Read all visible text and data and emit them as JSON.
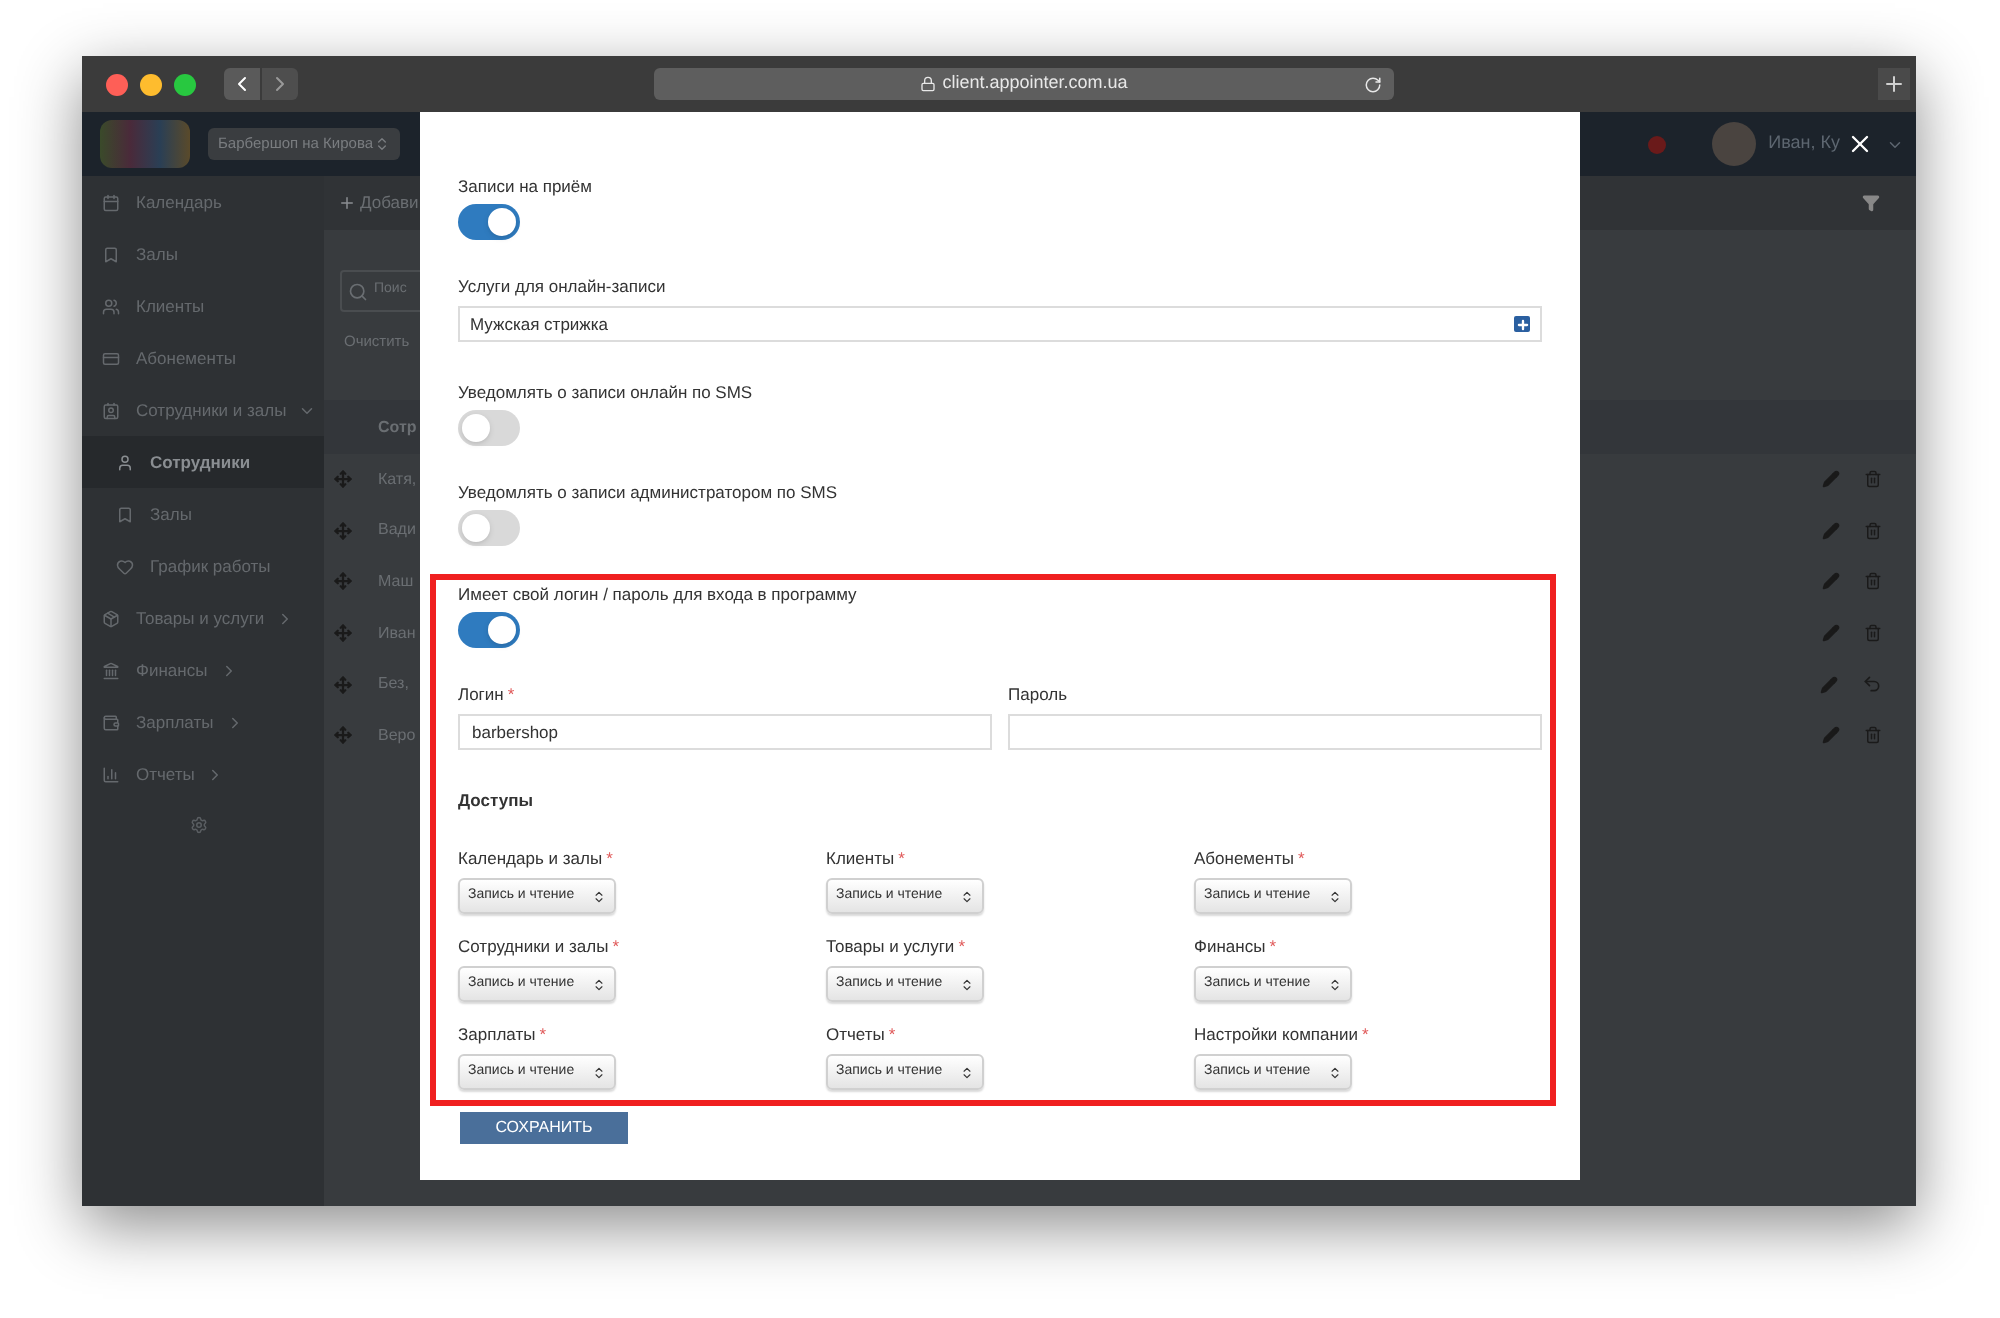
{
  "browser": {
    "url": "client.appointer.com.ua"
  },
  "app_header": {
    "company_select": "Барбершоп на Кирова",
    "user_name": "Иван, Ку"
  },
  "sidebar": {
    "items": [
      {
        "label": "Календарь",
        "kind": "link",
        "selected": false
      },
      {
        "label": "Залы",
        "kind": "link",
        "selected": false
      },
      {
        "label": "Клиенты",
        "kind": "link",
        "selected": false
      },
      {
        "label": "Абонементы",
        "kind": "link",
        "selected": false
      },
      {
        "label": "Сотрудники и залы",
        "kind": "group",
        "expanded": true,
        "selected": false,
        "children": [
          {
            "label": "Сотрудники",
            "selected": true
          },
          {
            "label": "Залы",
            "selected": false
          },
          {
            "label": "График работы",
            "selected": false
          }
        ]
      },
      {
        "label": "Товары и услуги",
        "kind": "group",
        "expanded": false,
        "selected": false
      },
      {
        "label": "Финансы",
        "kind": "group",
        "expanded": false,
        "selected": false
      },
      {
        "label": "Зарплаты",
        "kind": "group",
        "expanded": false,
        "selected": false
      },
      {
        "label": "Отчеты",
        "kind": "group",
        "expanded": false,
        "selected": false
      }
    ]
  },
  "toolbar": {
    "add_button": "Добави",
    "search_placeholder": "Поис",
    "clear_link": "Очистить"
  },
  "table": {
    "column_1": "Сотр",
    "rows": [
      {
        "name": "Катя,",
        "deleted": false
      },
      {
        "name": "Вади",
        "deleted": false
      },
      {
        "name": "Маш",
        "deleted": false
      },
      {
        "name": "Иван",
        "deleted": false
      },
      {
        "name": "Без,",
        "deleted": true
      },
      {
        "name": "Веро",
        "deleted": false
      }
    ]
  },
  "modal": {
    "required_mark": "*",
    "fields": [
      {
        "kind": "toggle",
        "label": "Записи на приём",
        "on": true
      },
      {
        "kind": "select",
        "label": "Услуги для онлайн-записи",
        "value": "Мужская стрижка"
      },
      {
        "kind": "toggle",
        "label": "Уведомлять о записи онлайн по SMS",
        "on": false
      },
      {
        "kind": "toggle",
        "label": "Уведомлять о записи администратором по SMS",
        "on": false
      }
    ],
    "login_toggle": {
      "label": "Имеет свой логин / пароль для входа в программу",
      "on": true
    },
    "login": {
      "label": "Логин",
      "required": true,
      "value": "barbershop"
    },
    "password": {
      "label": "Пароль",
      "required": false
    },
    "access_title": "Доступы",
    "access": [
      {
        "label": "Календарь и залы",
        "required": true,
        "value": "Запись и чтение"
      },
      {
        "label": "Клиенты",
        "required": true,
        "value": "Запись и чтение"
      },
      {
        "label": "Абонементы",
        "required": true,
        "value": "Запись и чтение"
      },
      {
        "label": "Сотрудники и залы",
        "required": true,
        "value": "Запись и чтение"
      },
      {
        "label": "Товары и услуги",
        "required": true,
        "value": "Запись и чтение"
      },
      {
        "label": "Финансы",
        "required": true,
        "value": "Запись и чтение"
      },
      {
        "label": "Зарплаты",
        "required": true,
        "value": "Запись и чтение"
      },
      {
        "label": "Отчеты",
        "required": true,
        "value": "Запись и чтение"
      },
      {
        "label": "Настройки компании",
        "required": true,
        "value": "Запись и чтение"
      }
    ],
    "save_button": "СОХРАНИТЬ"
  }
}
